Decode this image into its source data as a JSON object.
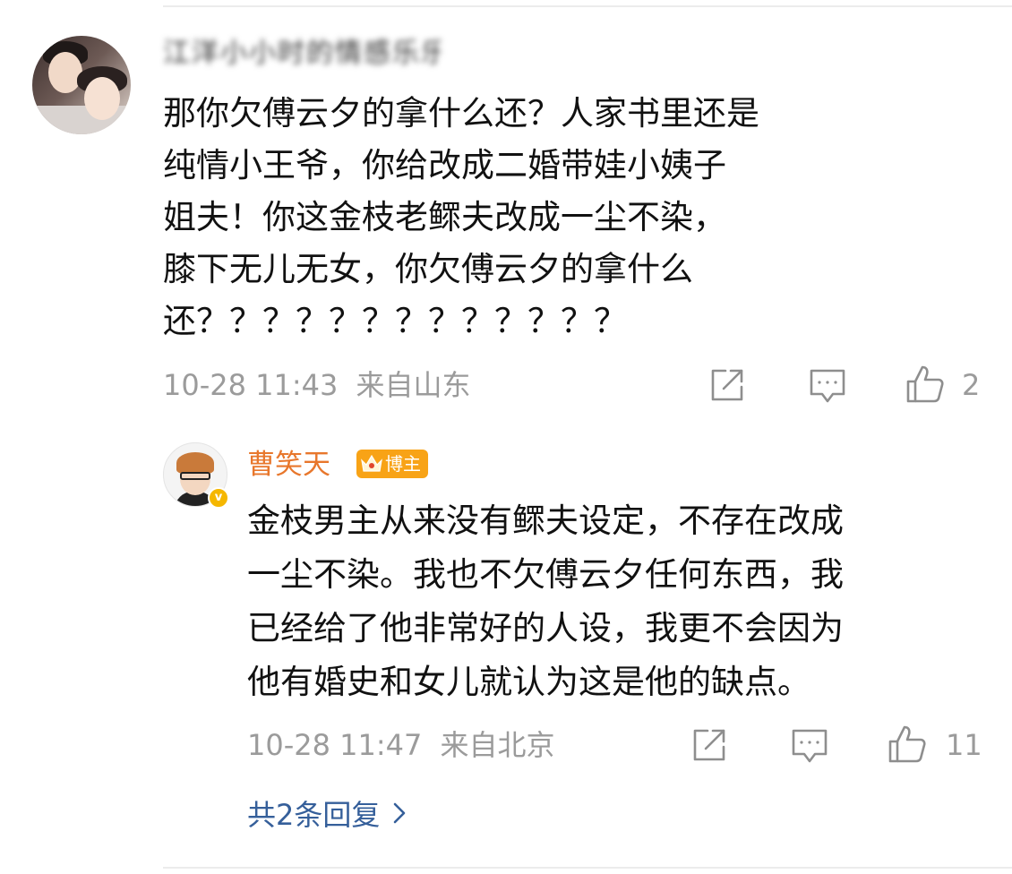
{
  "main_comment": {
    "username": "江洋小小时的情感乐乐",
    "text": "那你欠傅云夕的拿什么还？人家书里还是\n纯情小王爷，你给改成二婚带娃小姨子\n姐夫！你这金枝老鳏夫改成一尘不染，\n膝下无儿无女，你欠傅云夕的拿什么\n还？？？？？？？？？？？？？",
    "time": "10-28 11:43",
    "location": "来自山东",
    "like_count": "2"
  },
  "reply": {
    "username": "曹笑天",
    "badge": "博主",
    "text": "金枝男主从来没有鳏夫设定，不存在改成\n一尘不染。我也不欠傅云夕任何东西，我\n已经给了他非常好的人设，我更不会因为\n他有婚史和女儿就认为这是他的缺点。",
    "time": "10-28 11:47",
    "location": "来自北京",
    "like_count": "11"
  },
  "view_replies_label": "共2条回复",
  "colors": {
    "username_accent": "#e8772c",
    "badge_bg": "#f8a316",
    "link": "#355f9a",
    "meta_gray": "#9b9b9b"
  },
  "icons": [
    "share-icon",
    "comment-icon",
    "thumbs-up-icon",
    "chevron-right-icon",
    "crown-icon",
    "verified-icon"
  ]
}
